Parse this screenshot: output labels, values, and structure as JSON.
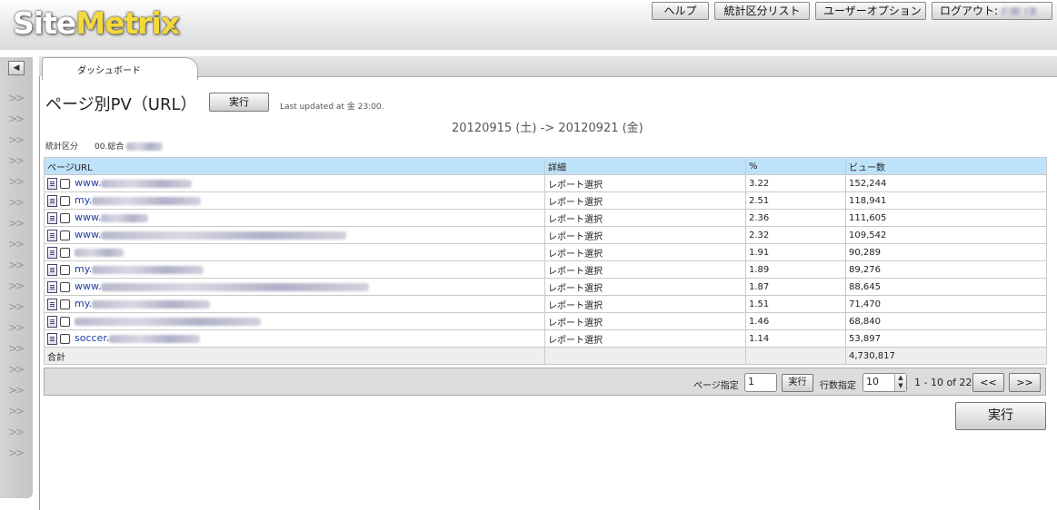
{
  "app": {
    "logo_site": "Site",
    "logo_metrix": "Metrix",
    "logo_caret": "⌄"
  },
  "header_buttons": {
    "help": "ヘルプ",
    "segment_list": "統計区分リスト",
    "user_options": "ユーザーオプション",
    "logout": "ログアウト:"
  },
  "tab": {
    "dashboard": "ダッシュボード"
  },
  "report": {
    "title": "ページ別PV（URL）",
    "run_label": "実行",
    "last_updated": "Last updated at 金 23:00.",
    "date_range": "20120915 (土) -> 20120921 (金)",
    "segment_label": "統計区分",
    "segment_value": "00.総合"
  },
  "table": {
    "headers": {
      "url": "ページURL",
      "detail": "詳細",
      "percent": "%",
      "views": "ビュー数"
    },
    "rows": [
      {
        "url_prefix": "www.",
        "detail": "レポート選択",
        "percent": "3.22",
        "views": "152,244"
      },
      {
        "url_prefix": "my.",
        "detail": "レポート選択",
        "percent": "2.51",
        "views": "118,941"
      },
      {
        "url_prefix": "www.",
        "detail": "レポート選択",
        "percent": "2.36",
        "views": "111,605"
      },
      {
        "url_prefix": "www.",
        "detail": "レポート選択",
        "percent": "2.32",
        "views": "109,542"
      },
      {
        "url_prefix": "",
        "detail": "レポート選択",
        "percent": "1.91",
        "views": "90,289"
      },
      {
        "url_prefix": "my.",
        "detail": "レポート選択",
        "percent": "1.89",
        "views": "89,276"
      },
      {
        "url_prefix": "www.",
        "detail": "レポート選択",
        "percent": "1.87",
        "views": "88,645"
      },
      {
        "url_prefix": "my.",
        "detail": "レポート選択",
        "percent": "1.51",
        "views": "71,470"
      },
      {
        "url_prefix": "",
        "detail": "レポート選択",
        "percent": "1.46",
        "views": "68,840"
      },
      {
        "url_prefix": "soccer.",
        "detail": "レポート選択",
        "percent": "1.14",
        "views": "53,897"
      }
    ],
    "total_label": "合計",
    "total_views": "4,730,817"
  },
  "pager": {
    "page_label": "ページ指定",
    "page_value": "1",
    "run_label": "実行",
    "rows_label": "行数指定",
    "rows_value": "10",
    "range_text": "1 - 10 of 22",
    "prev_label": "<<",
    "next_label": ">>"
  },
  "bottom": {
    "run_label": "実行"
  }
}
